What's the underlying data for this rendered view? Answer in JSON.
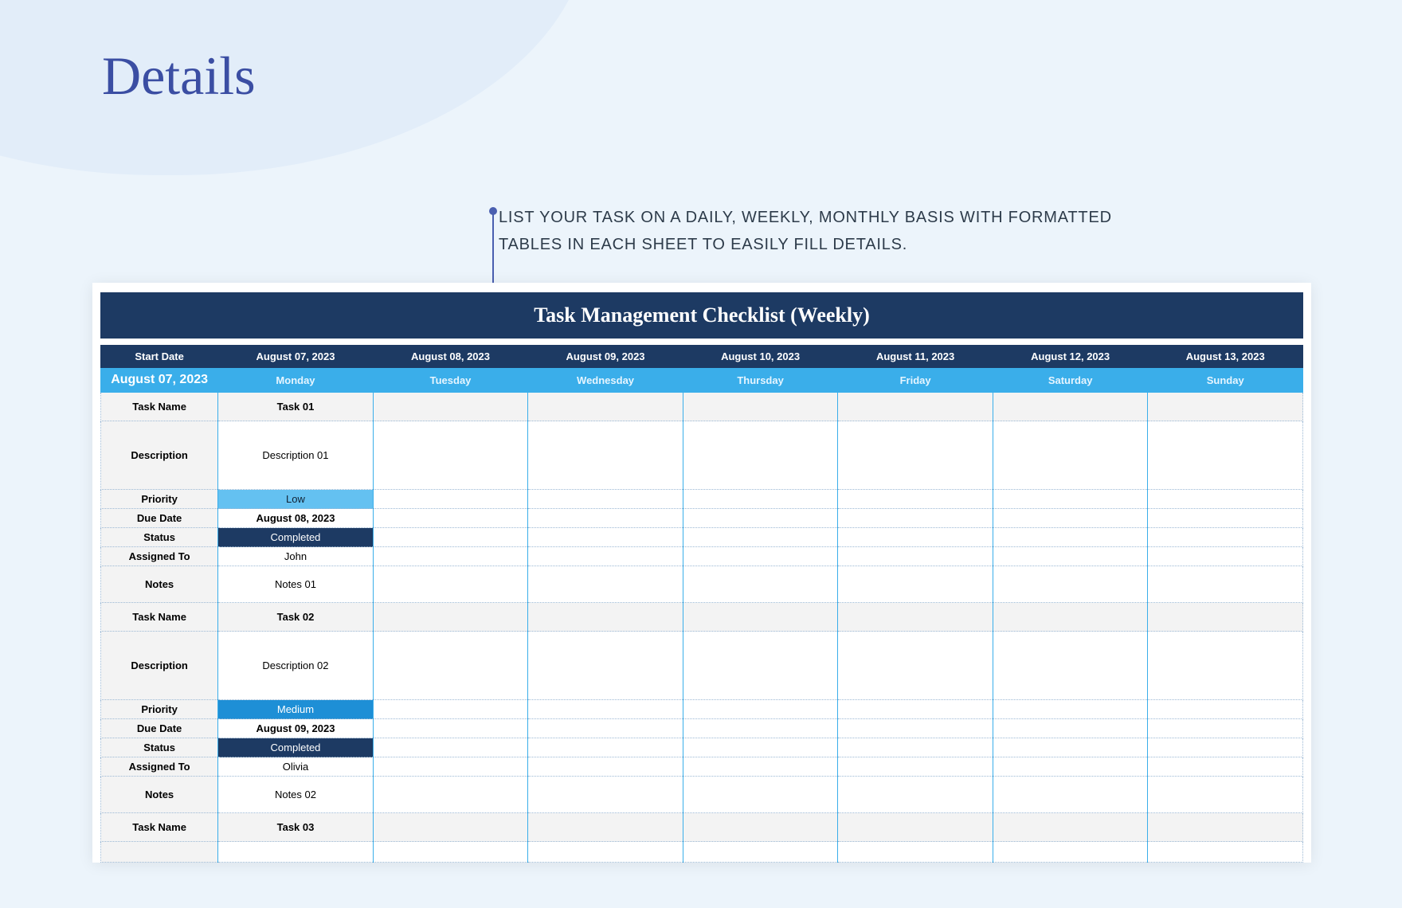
{
  "page": {
    "title": "Details",
    "callout": "LIST YOUR TASK ON A DAILY, WEEKLY, MONTHLY BASIS WITH FORMATTED TABLES IN EACH SHEET TO EASILY FILL DETAILS."
  },
  "sheet": {
    "title": "Task Management Checklist (Weekly)",
    "header": {
      "start_label": "Start Date",
      "start_value": "August 07, 2023",
      "dates": [
        "August 07, 2023",
        "August 08, 2023",
        "August 09, 2023",
        "August 10, 2023",
        "August 11, 2023",
        "August 12, 2023",
        "August 13, 2023"
      ],
      "days": [
        "Monday",
        "Tuesday",
        "Wednesday",
        "Thursday",
        "Friday",
        "Saturday",
        "Sunday"
      ]
    },
    "row_labels": {
      "task_name": "Task Name",
      "description": "Description",
      "priority": "Priority",
      "due_date": "Due Date",
      "status": "Status",
      "assigned_to": "Assigned To",
      "notes": "Notes"
    },
    "tasks": [
      {
        "name": "Task 01",
        "description": "Description 01",
        "priority": "Low",
        "priority_class": "priority-low",
        "due_date": "August 08, 2023",
        "status": "Completed",
        "assigned_to": "John",
        "notes": "Notes 01"
      },
      {
        "name": "Task 02",
        "description": "Description 02",
        "priority": "Medium",
        "priority_class": "priority-medium",
        "due_date": "August 09, 2023",
        "status": "Completed",
        "assigned_to": "Olivia",
        "notes": "Notes 02"
      },
      {
        "name": "Task 03"
      }
    ]
  }
}
